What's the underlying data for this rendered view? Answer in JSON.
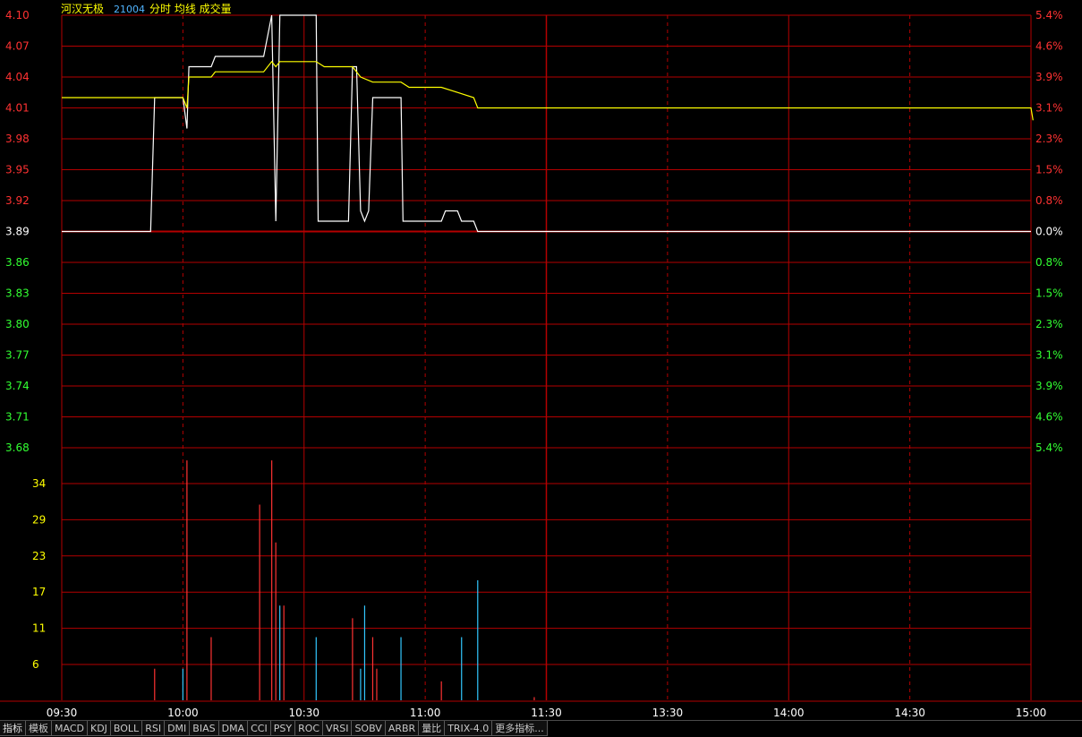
{
  "header": {
    "stock_name": "河汉无极",
    "stock_code": "21004",
    "chart_label": "分时 均线 成交量"
  },
  "colors": {
    "grid": "#b40000",
    "axis_up": "#ff3232",
    "axis_down": "#32ff32",
    "axis_neutral": "#ffffff",
    "volume_axis": "#ffff00",
    "price_line": "#ffffff",
    "avg_line": "#ffff00",
    "volume_up": "#ff3232",
    "volume_down": "#32c8ff",
    "header_name": "#ffff00",
    "header_code": "#50b4ff"
  },
  "chart_data": {
    "type": "line",
    "previous_close": 3.89,
    "price_axis": {
      "ticks": [
        "4.10",
        "4.07",
        "4.04",
        "4.01",
        "3.98",
        "3.95",
        "3.92",
        "3.89",
        "3.86",
        "3.83",
        "3.80",
        "3.77",
        "3.74",
        "3.71",
        "3.68"
      ],
      "range": [
        3.68,
        4.1
      ]
    },
    "percent_axis": {
      "ticks": [
        "5.4%",
        "4.6%",
        "3.9%",
        "3.1%",
        "2.3%",
        "1.5%",
        "0.8%",
        "0.0%",
        "0.8%",
        "1.5%",
        "2.3%",
        "3.1%",
        "3.9%",
        "4.6%",
        "5.4%"
      ]
    },
    "volume_axis": {
      "ticks": [
        "34",
        "29",
        "23",
        "17",
        "11",
        "6"
      ],
      "range": [
        0,
        40
      ]
    },
    "x_ticks": [
      "09:30",
      "10:00",
      "10:30",
      "11:00",
      "11:30",
      "13:30",
      "14:00",
      "14:30",
      "15:00"
    ],
    "series": [
      {
        "key": "price",
        "points": [
          [
            0,
            3.89
          ],
          [
            22,
            3.89
          ],
          [
            23,
            4.02
          ],
          [
            30,
            4.02
          ],
          [
            31,
            3.99
          ],
          [
            31.5,
            4.05
          ],
          [
            37,
            4.05
          ],
          [
            38,
            4.06
          ],
          [
            50,
            4.06
          ],
          [
            52,
            4.1
          ],
          [
            53,
            3.9
          ],
          [
            54,
            4.1
          ],
          [
            63,
            4.1
          ],
          [
            63.5,
            3.9
          ],
          [
            71,
            3.9
          ],
          [
            72,
            4.05
          ],
          [
            73,
            4.05
          ],
          [
            74,
            3.91
          ],
          [
            75,
            3.9
          ],
          [
            76,
            3.91
          ],
          [
            77,
            4.02
          ],
          [
            84,
            4.02
          ],
          [
            84.5,
            3.9
          ],
          [
            94,
            3.9
          ],
          [
            95,
            3.91
          ],
          [
            98,
            3.91
          ],
          [
            99,
            3.9
          ],
          [
            102,
            3.9
          ],
          [
            103,
            3.89
          ],
          [
            240,
            3.89
          ]
        ]
      },
      {
        "key": "average",
        "points": [
          [
            0,
            4.02
          ],
          [
            23,
            4.02
          ],
          [
            30,
            4.02
          ],
          [
            31,
            4.01
          ],
          [
            31.5,
            4.04
          ],
          [
            37,
            4.04
          ],
          [
            38,
            4.045
          ],
          [
            50,
            4.045
          ],
          [
            52,
            4.055
          ],
          [
            53,
            4.05
          ],
          [
            54,
            4.055
          ],
          [
            63,
            4.055
          ],
          [
            65,
            4.05
          ],
          [
            72,
            4.05
          ],
          [
            74,
            4.04
          ],
          [
            77,
            4.035
          ],
          [
            84,
            4.035
          ],
          [
            86,
            4.03
          ],
          [
            94,
            4.03
          ],
          [
            98,
            4.025
          ],
          [
            102,
            4.02
          ],
          [
            103,
            4.01
          ],
          [
            240,
            4.01
          ],
          [
            240.5,
            3.998
          ]
        ]
      }
    ],
    "volume_bars": [
      {
        "t": 23,
        "v": 5,
        "dir": "up"
      },
      {
        "t": 30,
        "v": 5,
        "dir": "down"
      },
      {
        "t": 31,
        "v": 38,
        "dir": "up"
      },
      {
        "t": 37,
        "v": 10,
        "dir": "up"
      },
      {
        "t": 49,
        "v": 31,
        "dir": "up"
      },
      {
        "t": 52,
        "v": 38,
        "dir": "up"
      },
      {
        "t": 53,
        "v": 25,
        "dir": "up"
      },
      {
        "t": 54,
        "v": 15,
        "dir": "down"
      },
      {
        "t": 55,
        "v": 15,
        "dir": "up"
      },
      {
        "t": 63,
        "v": 10,
        "dir": "down"
      },
      {
        "t": 72,
        "v": 13,
        "dir": "up"
      },
      {
        "t": 74,
        "v": 5,
        "dir": "down"
      },
      {
        "t": 75,
        "v": 15,
        "dir": "down"
      },
      {
        "t": 77,
        "v": 10,
        "dir": "up"
      },
      {
        "t": 78,
        "v": 5,
        "dir": "up"
      },
      {
        "t": 84,
        "v": 10,
        "dir": "down"
      },
      {
        "t": 94,
        "v": 3,
        "dir": "up"
      },
      {
        "t": 99,
        "v": 10,
        "dir": "down"
      },
      {
        "t": 103,
        "v": 19,
        "dir": "down"
      },
      {
        "t": 117,
        "v": 0.5,
        "dir": "up"
      }
    ]
  },
  "tabs": [
    "指标",
    "模板",
    "MACD",
    "KDJ",
    "BOLL",
    "RSI",
    "DMI",
    "BIAS",
    "DMA",
    "CCI",
    "PSY",
    "ROC",
    "VRSI",
    "SOBV",
    "ARBR",
    "量比",
    "TRIX-4.0",
    "更多指标..."
  ]
}
